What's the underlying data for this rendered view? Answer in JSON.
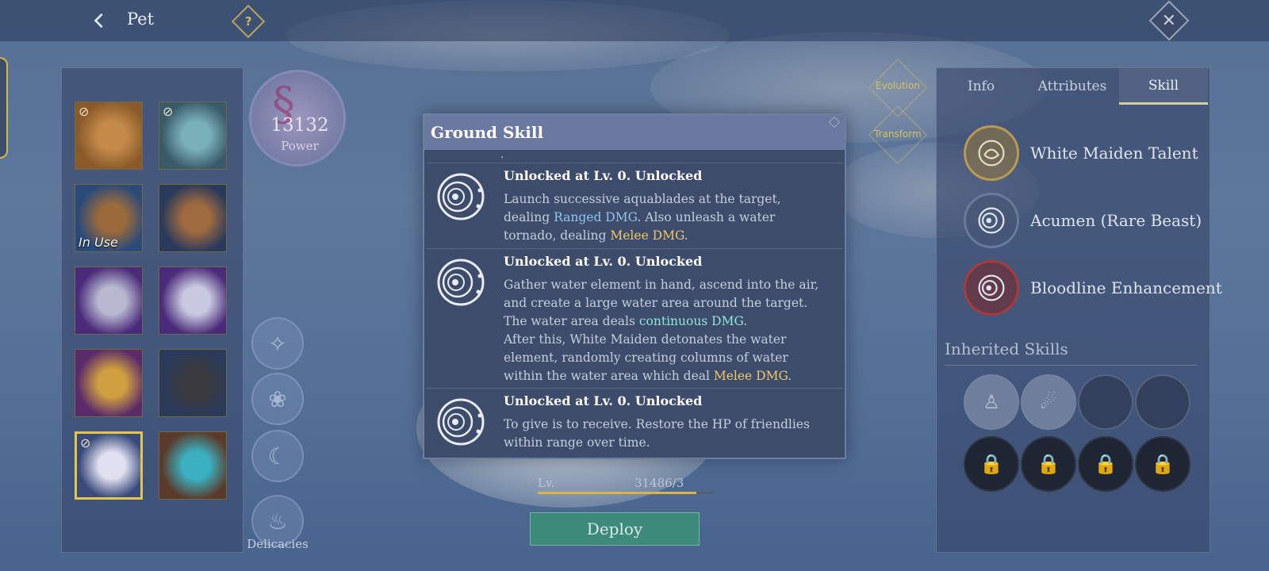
{
  "header": {
    "back_icon": "chevron-left-icon",
    "title": "Pet",
    "help_label": "?",
    "close_label": "✕"
  },
  "pets": [
    {
      "name": "pet-slot-lion",
      "locked": true,
      "in_use": false,
      "selected": false,
      "colors": [
        "#8a5a2a",
        "#c48a4a"
      ]
    },
    {
      "name": "pet-slot-sea-dragon",
      "locked": true,
      "in_use": false,
      "selected": false,
      "colors": [
        "#3a5a6a",
        "#7ab0b8"
      ]
    },
    {
      "name": "pet-slot-horse",
      "locked": false,
      "in_use": true,
      "selected": false,
      "colors": [
        "#2a4a7a",
        "#9a6a3a"
      ]
    },
    {
      "name": "pet-slot-rock-beast",
      "locked": false,
      "in_use": false,
      "selected": false,
      "colors": [
        "#2a3a5a",
        "#a06a40"
      ]
    },
    {
      "name": "pet-slot-white-wolf",
      "locked": false,
      "in_use": false,
      "selected": false,
      "colors": [
        "#4a2a7a",
        "#b8b8d0"
      ]
    },
    {
      "name": "pet-slot-ghost-fish",
      "locked": false,
      "in_use": false,
      "selected": false,
      "colors": [
        "#4a2a7a",
        "#c8c8e0"
      ]
    },
    {
      "name": "pet-slot-golden-dragon",
      "locked": false,
      "in_use": false,
      "selected": false,
      "colors": [
        "#5a2a6a",
        "#d0a040"
      ]
    },
    {
      "name": "pet-slot-black-wolf",
      "locked": false,
      "in_use": false,
      "selected": false,
      "colors": [
        "#2a3a5a",
        "#3a3a40"
      ]
    },
    {
      "name": "pet-slot-white-maiden",
      "locked": true,
      "in_use": false,
      "selected": true,
      "colors": [
        "#3a4a7a",
        "#e0e0f0"
      ]
    },
    {
      "name": "pet-slot-water-dragon",
      "locked": false,
      "in_use": false,
      "selected": false,
      "colors": [
        "#5a3a2a",
        "#3ab0c0"
      ]
    }
  ],
  "pet_labels": {
    "in_use": "In Use",
    "lock": "🔒"
  },
  "power": {
    "value": "13132",
    "label": "Power"
  },
  "side_actions": {
    "delicacies": "Delicacies"
  },
  "evolution": {
    "evolution_label": "Evolution",
    "transform_label": "Transform"
  },
  "status": {
    "level": "Lv.",
    "hp": "31486/3",
    "level_progress": 0.9
  },
  "deploy_label": "Deploy",
  "tabs": [
    {
      "label": "Info",
      "active": false
    },
    {
      "label": "Attributes",
      "active": false
    },
    {
      "label": "Skill",
      "active": true
    }
  ],
  "talents": [
    {
      "label": "White Maiden Talent",
      "icon": "lion-head-icon",
      "ring": "#b89a55"
    },
    {
      "label": "Acumen (Rare Beast)",
      "icon": "crescent-moon-icon",
      "ring": "#6a7a9a"
    },
    {
      "label": "Bloodline Enhancement",
      "icon": "crescent-moon-icon",
      "ring": "#a83a3a"
    }
  ],
  "inherited": {
    "title": "Inherited Skills",
    "slots": [
      {
        "state": "filled",
        "icon": "body-silhouette-icon"
      },
      {
        "state": "filled",
        "icon": "claw-swirl-icon"
      },
      {
        "state": "empty",
        "icon": ""
      },
      {
        "state": "empty",
        "icon": ""
      },
      {
        "state": "locked",
        "icon": "lock-icon"
      },
      {
        "state": "locked",
        "icon": "lock-icon"
      },
      {
        "state": "locked",
        "icon": "lock-icon"
      },
      {
        "state": "locked",
        "icon": "lock-icon"
      }
    ]
  },
  "modal": {
    "title": "Ground Skill",
    "dot": ".",
    "skills": [
      {
        "head": "Unlocked at Lv. 0.  Unlocked",
        "segments": [
          {
            "text": "Launch successive aquablades at the target, dealing ",
            "style": ""
          },
          {
            "text": "Ranged DMG",
            "style": "hl-blue"
          },
          {
            "text": ". Also unleash a water tornado, dealing ",
            "style": ""
          },
          {
            "text": "Melee DMG",
            "style": "hl-gold"
          },
          {
            "text": ".",
            "style": ""
          }
        ]
      },
      {
        "head": "Unlocked at Lv. 0.  Unlocked",
        "segments": [
          {
            "text": "Gather water element in hand, ascend into the air, and create a large water area around the target. The water area deals ",
            "style": ""
          },
          {
            "text": "continuous DMG",
            "style": "hl-cyan"
          },
          {
            "text": ".",
            "style": ""
          },
          {
            "text": "\nAfter this, White Maiden detonates the water element, randomly creating columns of water within the water area which deal ",
            "style": ""
          },
          {
            "text": "Melee DMG",
            "style": "hl-gold"
          },
          {
            "text": ".",
            "style": ""
          }
        ]
      },
      {
        "head": "Unlocked at Lv. 0.  Unlocked",
        "segments": [
          {
            "text": "To give is to receive. Restore the HP of friendlies within range over time.",
            "style": ""
          }
        ]
      }
    ]
  }
}
